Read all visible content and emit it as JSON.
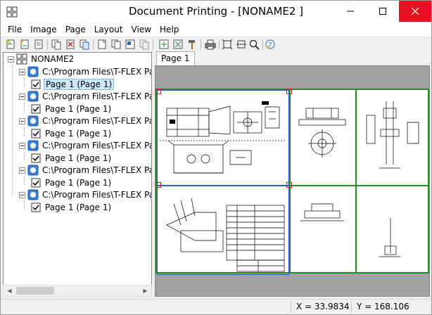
{
  "window": {
    "title": "Document Printing - [NONAME2 ]"
  },
  "menu": [
    "File",
    "Image",
    "Page",
    "Layout",
    "View",
    "Help"
  ],
  "tree": {
    "root": "NONAME2",
    "groups": [
      {
        "path": "C:\\Program Files\\T-FLEX Paran",
        "page": "Page 1 (Page 1)",
        "selected": true
      },
      {
        "path": "C:\\Program Files\\T-FLEX Paran",
        "page": "Page 1 (Page 1)",
        "selected": false
      },
      {
        "path": "C:\\Program Files\\T-FLEX Paran",
        "page": "Page 1 (Page 1)",
        "selected": false
      },
      {
        "path": "C:\\Program Files\\T-FLEX Paran",
        "page": "Page 1 (Page 1)",
        "selected": false
      },
      {
        "path": "C:\\Program Files\\T-FLEX Paran",
        "page": "Page 1 (Page 1)",
        "selected": false
      },
      {
        "path": "C:\\Program Files\\T-FLEX Paran",
        "page": "Page 1 (Page 1)",
        "selected": false
      }
    ]
  },
  "preview": {
    "tab": "Page 1"
  },
  "status": {
    "x": "X = 33.9834",
    "y": "Y = 168.106"
  },
  "colors": {
    "sheet_border": "#2a8a2a",
    "frame": "#2c5fbf",
    "marker": "#d42020",
    "selection": "#cce8ff",
    "close_button": "#e81123"
  }
}
